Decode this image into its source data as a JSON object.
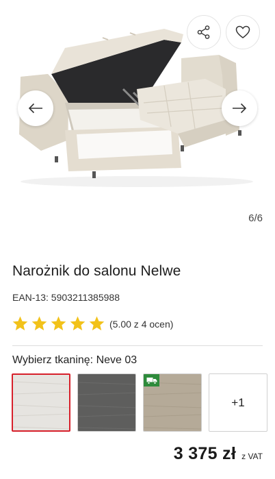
{
  "product": {
    "title": "Narożnik do salonu Nelwe",
    "ean": "EAN-13: 5903211385988",
    "rating_value": 5.0,
    "rating_text": "(5.00 z 4 ocen)",
    "stars_total": 5
  },
  "gallery": {
    "counter": "6/6",
    "icons": {
      "share": "share-icon",
      "favorite": "heart-icon",
      "prev": "arrow-left-icon",
      "next": "arrow-right-icon"
    }
  },
  "fabric": {
    "label": "Wybierz tkaninę: Neve 03",
    "swatches": [
      {
        "name": "Neve 03",
        "color": "#e6e4e0",
        "selected": true
      },
      {
        "name": "grey",
        "color": "#5e5e5d",
        "selected": false
      },
      {
        "name": "beige",
        "color": "#b5aa98",
        "selected": false,
        "badge": "truck-icon"
      }
    ],
    "more_label": "+1"
  },
  "price": {
    "value": "3 375 zł",
    "vat": "z VAT"
  },
  "colors": {
    "star": "#f2c21a",
    "selected_border": "#d71f2a",
    "badge": "#2e8b3b"
  }
}
